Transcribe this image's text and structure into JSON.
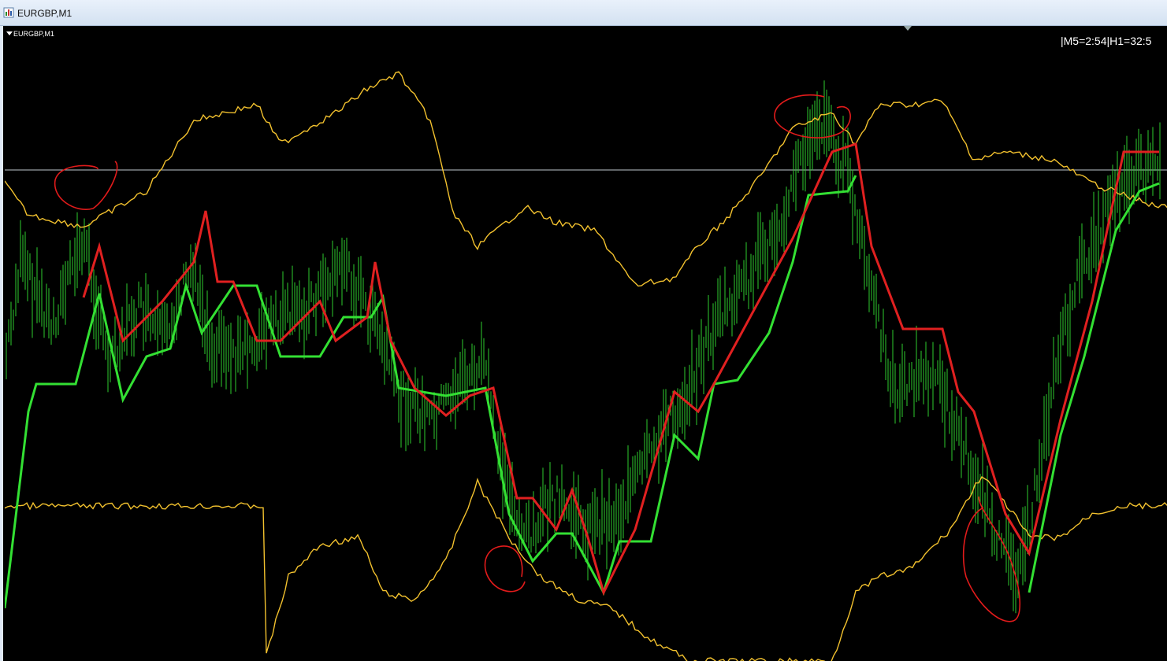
{
  "window": {
    "title": "EURGBP,M1"
  },
  "chart": {
    "symbol_label": "EURGBP,M1",
    "timer_text": "|M5=2:54|H1=32:5",
    "colors": {
      "background": "#000000",
      "bars": "#2ecc2e",
      "band": "#f2c12e",
      "signal_up": "#33e033",
      "signal_down": "#e02020",
      "level_line": "#c0c8d0",
      "annotation": "#e21b1b"
    }
  }
}
